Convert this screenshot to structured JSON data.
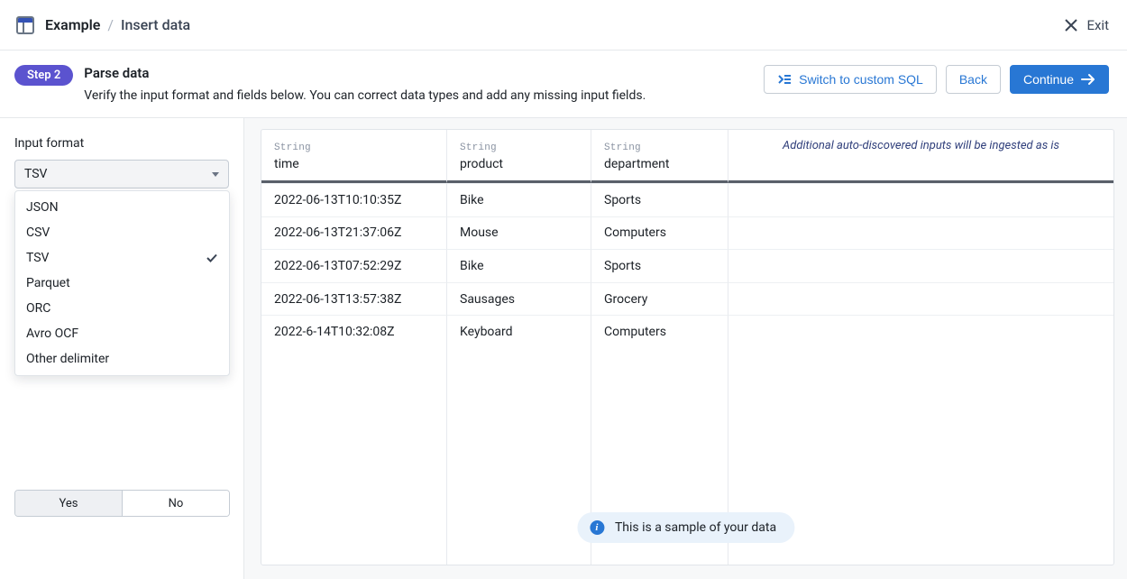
{
  "breadcrumb": {
    "app": "Example",
    "page": "Insert data"
  },
  "exit_label": "Exit",
  "step": {
    "pill": "Step 2",
    "title": "Parse data",
    "desc": "Verify the input format and fields below. You can correct data types and add any missing input fields."
  },
  "buttons": {
    "switch_sql": "Switch to custom SQL",
    "back": "Back",
    "continue": "Continue"
  },
  "sidebar": {
    "input_format_label": "Input format",
    "input_format_value": "TSV",
    "dropdown_options": [
      {
        "label": "JSON",
        "selected": false
      },
      {
        "label": "CSV",
        "selected": false
      },
      {
        "label": "TSV",
        "selected": true
      },
      {
        "label": "Parquet",
        "selected": false
      },
      {
        "label": "ORC",
        "selected": false
      },
      {
        "label": "Avro OCF",
        "selected": false
      },
      {
        "label": "Other delimiter",
        "selected": false
      }
    ],
    "segmented": {
      "yes": "Yes",
      "no": "No",
      "active": "yes"
    }
  },
  "table": {
    "columns": [
      {
        "type": "String",
        "name": "time"
      },
      {
        "type": "String",
        "name": "product"
      },
      {
        "type": "String",
        "name": "department"
      }
    ],
    "extra_note": "Additional auto-discovered inputs will be ingested as is",
    "rows": [
      {
        "time": "2022-06-13T10:10:35Z",
        "product": "Bike",
        "department": "Sports"
      },
      {
        "time": "2022-06-13T21:37:06Z",
        "product": "Mouse",
        "department": "Computers"
      },
      {
        "time": "2022-06-13T07:52:29Z",
        "product": "Bike",
        "department": "Sports"
      },
      {
        "time": "2022-06-13T13:57:38Z",
        "product": "Sausages",
        "department": "Grocery"
      },
      {
        "time": "2022-6-14T10:32:08Z",
        "product": "Keyboard",
        "department": "Computers"
      }
    ]
  },
  "toast": "This is a sample of your data"
}
